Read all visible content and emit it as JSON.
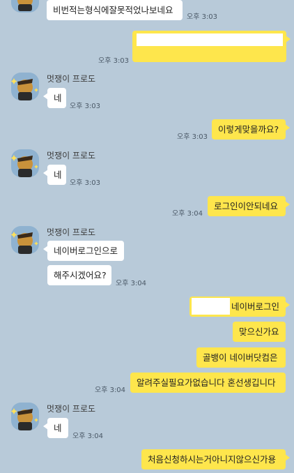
{
  "sender": {
    "name": "멋쟁이 프로도"
  },
  "messages": {
    "m0_text": "비번적는형식에잘못적었나보네요",
    "m0_time": "오후 3:03",
    "m1_time": "오후 3:03",
    "m2_text": "네",
    "m2_time": "오후 3:03",
    "m3_text": "이렇게맞을까요?",
    "m3_time": "오후 3:03",
    "m4_text": "네",
    "m4_time": "오후 3:03",
    "m5_text": "로그인이안되네요",
    "m5_time": "오후 3:04",
    "m6_text": "네이버로그인으로",
    "m7_text": "해주시겠어요?",
    "m7_time": "오후 3:04",
    "m8_text": "네이버로그인",
    "m9_text": "맞으신가요",
    "m10_text": "골뱅이 네이버닷컴은",
    "m11_text": "알려주실필요가없습니다 혼선생깁니다",
    "m11_time": "오후 3:04",
    "m12_text": "네",
    "m12_time": "오후 3:04",
    "m13_text": "처음신청하시는거아니지않으신가용"
  },
  "colors": {
    "background": "#b8cad9",
    "outgoing_bubble": "#fee64c",
    "incoming_bubble": "#ffffff"
  },
  "icons": {
    "avatar": "frodo-character-avatar"
  }
}
